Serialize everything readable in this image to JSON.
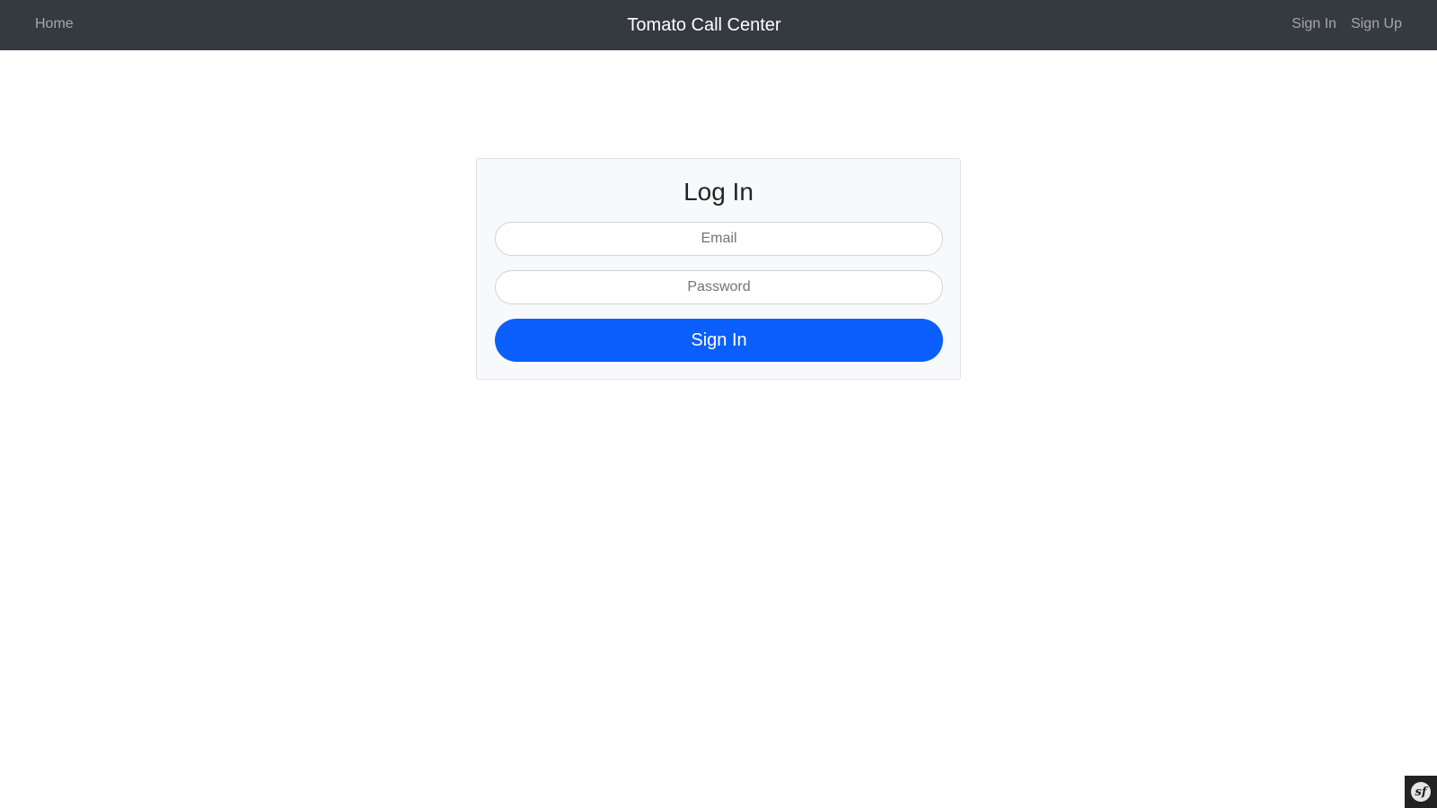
{
  "navbar": {
    "home_label": "Home",
    "brand": "Tomato Call Center",
    "sign_in_label": "Sign In",
    "sign_up_label": "Sign Up",
    "background": "#343a40"
  },
  "login": {
    "title": "Log In",
    "email_placeholder": "Email",
    "password_placeholder": "Password",
    "submit_label": "Sign In",
    "accent": "#0a5ffd"
  },
  "debug_toolbar": {
    "icon": "symfony-logo-icon",
    "glyph": "sf"
  }
}
